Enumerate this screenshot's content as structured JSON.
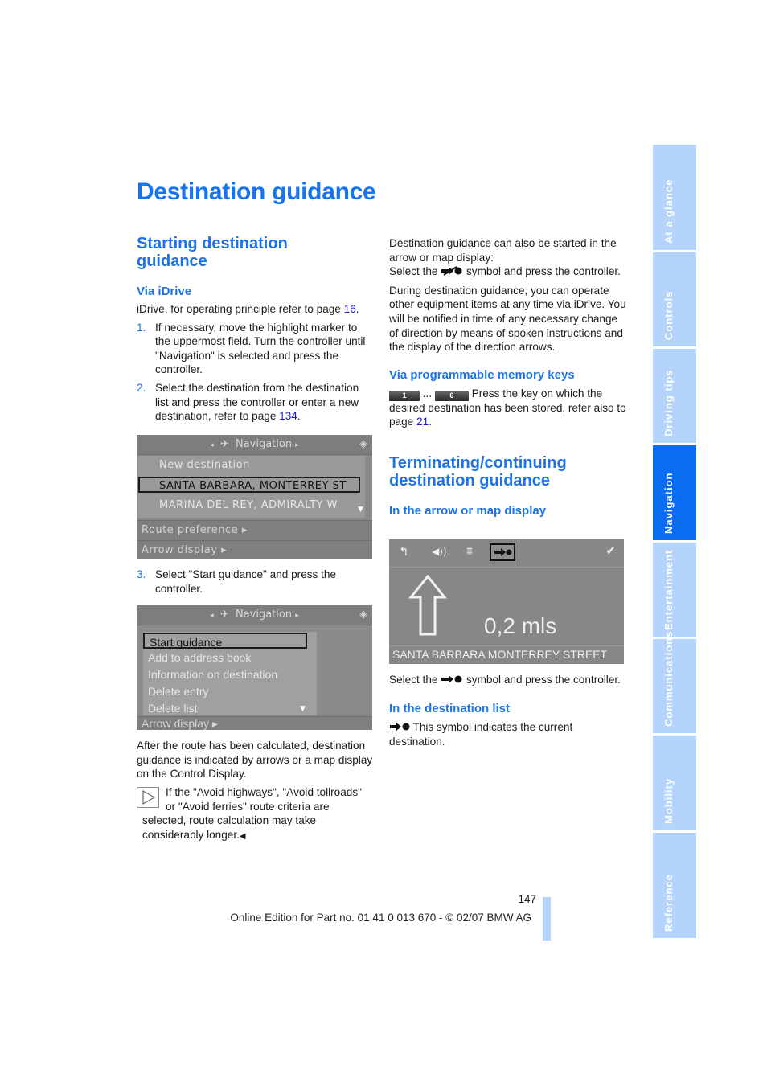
{
  "page": {
    "title": "Destination guidance",
    "page_number": "147",
    "footer": "Online Edition for Part no. 01 41 0 013 670 - © 02/07 BMW AG"
  },
  "side_tabs": [
    {
      "label": "At a glance",
      "active": false
    },
    {
      "label": "Controls",
      "active": false
    },
    {
      "label": "Driving tips",
      "active": false
    },
    {
      "label": "Navigation",
      "active": true
    },
    {
      "label": "Entertainment",
      "active": false
    },
    {
      "label": "Communications",
      "active": false
    },
    {
      "label": "Mobility",
      "active": false
    },
    {
      "label": "Reference",
      "active": false
    }
  ],
  "left": {
    "section_title": "Starting destination guidance",
    "section_title_l1": "Starting destination",
    "section_title_l2": "guidance",
    "via_idrive": {
      "heading": "Via iDrive",
      "intro_prefix": "iDrive, for operating principle refer to page ",
      "intro_link": "16",
      "intro_suffix": ".",
      "steps": [
        {
          "num": "1.",
          "text": "If necessary, move the highlight marker to the uppermost field. Turn the controller until \"Navigation\" is selected and press the controller."
        },
        {
          "num": "2.",
          "text_prefix": "Select the destination from the destination list and press the controller or enter a new destination, refer to page ",
          "link": "134",
          "text_suffix": "."
        },
        {
          "num": "3.",
          "text": "Select \"Start guidance\" and press the controller."
        }
      ]
    },
    "screen1": {
      "header": "Navigation",
      "items": [
        "New destination",
        "SANTA BARBARA, MONTERREY ST",
        "MARINA DEL REY, ADMIRALTY W"
      ],
      "selected_index": 1,
      "footer_items": [
        "Route preference ▸",
        "Arrow display ▸"
      ]
    },
    "screen2": {
      "header": "Navigation",
      "items": [
        "Start guidance",
        "Add to address book",
        "Information on destination",
        "Delete entry",
        "Delete list"
      ],
      "selected_index": 0,
      "footer_items": [
        "Arrow display ▸"
      ]
    },
    "after_route": "After the route has been calculated, destination guidance is indicated by arrows or a map display on the Control Display.",
    "note": "If the \"Avoid highways\", \"Avoid tollroads\" or \"Avoid ferries\" route criteria are selected, route calculation may take considerably longer.",
    "note_end": "◀"
  },
  "right": {
    "intro_p1": "Destination guidance can also be started in the arrow or map display:",
    "select_prefix": "Select the ",
    "select_suffix": " symbol and press the controller.",
    "intro_p2": "During destination guidance, you can operate other equipment items at any time via iDrive. You will be notified in time of any necessary change of direction by means of spoken instructions and the display of the direction arrows.",
    "memory_keys": {
      "heading": "Via programmable memory keys",
      "key_first": "1",
      "ellipsis": "...",
      "key_last": "6",
      "text_prefix": "Press the key on which the desired destination has been stored, refer also to page ",
      "link": "21",
      "text_suffix": "."
    },
    "section_title_l1": "Terminating/continuing",
    "section_title_l2": "destination guidance",
    "arrow_display": {
      "heading": "In the arrow or map display",
      "distance": "0,2 mls",
      "street": "SANTA BARBARA MONTERREY STREET",
      "select_prefix": "Select the ",
      "select_suffix": " symbol and press the controller."
    },
    "dest_list": {
      "heading": "In the destination list",
      "text": "This symbol indicates the current destination."
    }
  }
}
